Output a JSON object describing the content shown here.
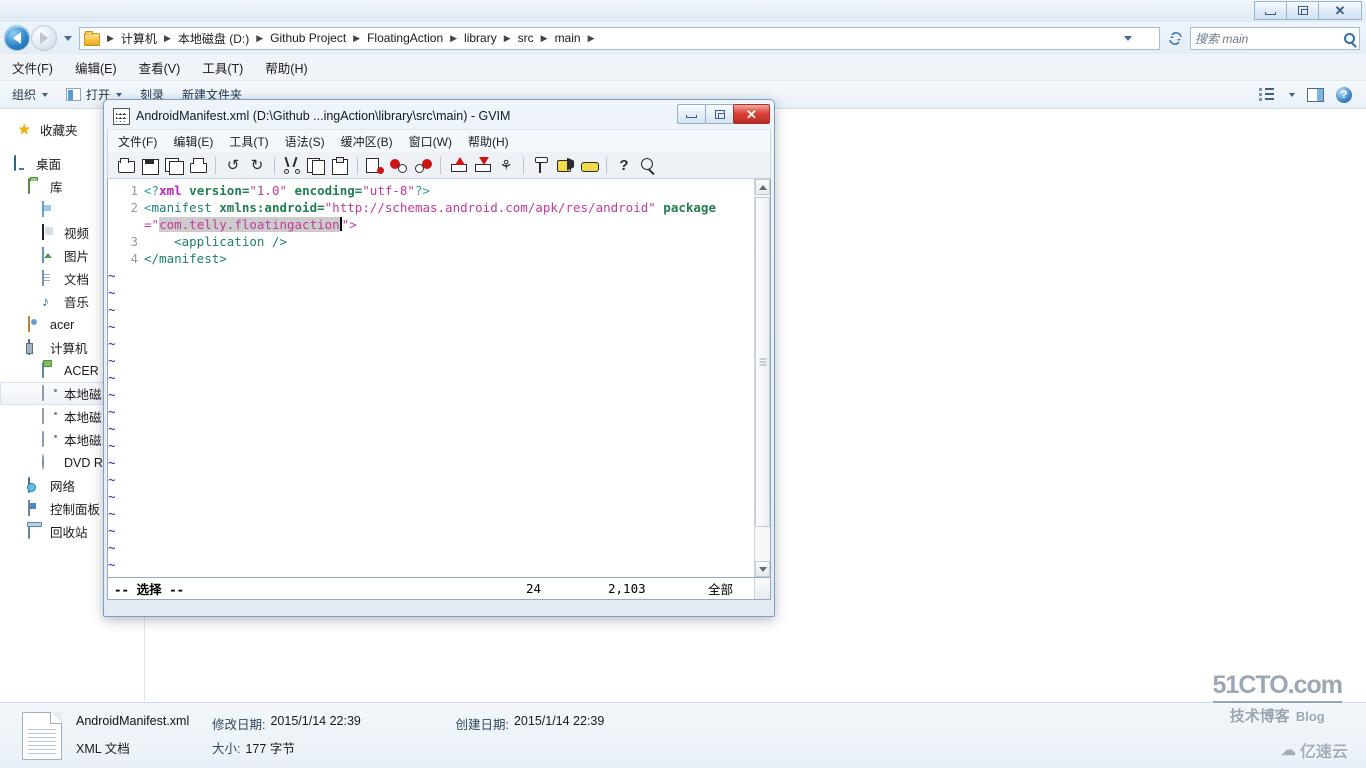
{
  "explorer": {
    "window_buttons": [
      "minimize",
      "restore",
      "close"
    ],
    "nav": {
      "back": "back-arrow",
      "forward": "forward-arrow",
      "history": "recent-pages-dropdown"
    },
    "breadcrumb": {
      "folder_icon": "folder-icon",
      "items": [
        "计算机",
        "本地磁盘 (D:)",
        "Github Project",
        "FloatingAction",
        "library",
        "src",
        "main"
      ],
      "separator": "▶"
    },
    "refresh_icon": "refresh-icon",
    "search": {
      "placeholder": "搜索 main",
      "icon": "search-icon"
    },
    "menu": [
      "文件(F)",
      "编辑(E)",
      "查看(V)",
      "工具(T)",
      "帮助(H)"
    ],
    "toolbar": {
      "organize": "组织",
      "open": "打开",
      "burn": "刻录",
      "new_folder": "新建文件夹",
      "view_icon": "view-options-icon",
      "preview_icon": "preview-pane-icon",
      "help_icon": "help-icon"
    },
    "tree": [
      {
        "label": "收藏夹",
        "icon": "favorites-star-icon",
        "indent": 18,
        "selected": false
      },
      {
        "label": "桌面",
        "icon": "desktop-icon",
        "indent": 14,
        "selected": false
      },
      {
        "label": "库",
        "icon": "libraries-icon",
        "indent": 28,
        "selected": false
      },
      {
        "label": "",
        "icon": "library-doc-icon",
        "indent": 42,
        "selected": false
      },
      {
        "label": "视频",
        "icon": "videos-icon",
        "indent": 42,
        "selected": false
      },
      {
        "label": "图片",
        "icon": "pictures-icon",
        "indent": 42,
        "selected": false
      },
      {
        "label": "文档",
        "icon": "documents-icon",
        "indent": 42,
        "selected": false
      },
      {
        "label": "音乐",
        "icon": "music-icon",
        "indent": 42,
        "selected": false
      },
      {
        "label": "acer",
        "icon": "user-folder-icon",
        "indent": 28,
        "selected": false
      },
      {
        "label": "计算机",
        "icon": "computer-icon",
        "indent": 28,
        "selected": false
      },
      {
        "label": "ACER (",
        "icon": "system-drive-icon",
        "indent": 42,
        "selected": false
      },
      {
        "label": "本地磁",
        "icon": "hard-drive-icon",
        "indent": 42,
        "selected": true
      },
      {
        "label": "本地磁",
        "icon": "hard-drive-icon",
        "indent": 42,
        "selected": false
      },
      {
        "label": "本地磁",
        "icon": "hard-drive-icon",
        "indent": 42,
        "selected": false
      },
      {
        "label": "DVD R",
        "icon": "dvd-drive-icon",
        "indent": 42,
        "selected": false
      },
      {
        "label": "网络",
        "icon": "network-icon",
        "indent": 28,
        "selected": false
      },
      {
        "label": "控制面板",
        "icon": "control-panel-icon",
        "indent": 28,
        "selected": false
      },
      {
        "label": "回收站",
        "icon": "recycle-bin-icon",
        "indent": 28,
        "selected": false
      }
    ],
    "details": {
      "file_icon": "xml-file-icon",
      "name": "AndroidManifest.xml",
      "modified_key": "修改日期:",
      "modified_value": "2015/1/14 22:39",
      "created_key": "创建日期:",
      "created_value": "2015/1/14 22:39",
      "type": "XML 文档",
      "size_key": "大小:",
      "size_value": "177 字节"
    }
  },
  "gvim": {
    "icon": "gvim-icon",
    "title": "AndroidManifest.xml (D:\\Github ...ingAction\\library\\src\\main) - GVIM",
    "window_buttons": [
      "minimize",
      "restore",
      "close"
    ],
    "menu": [
      "文件(F)",
      "编辑(E)",
      "工具(T)",
      "语法(S)",
      "缓冲区(B)",
      "窗口(W)",
      "帮助(H)"
    ],
    "toolbar_icons": [
      "open-file-icon",
      "save-file-icon",
      "save-all-icon",
      "print-icon",
      "undo-icon",
      "redo-icon",
      "cut-icon",
      "copy-icon",
      "paste-icon",
      "find-replace-icon",
      "find-next-icon",
      "find-previous-icon",
      "load-session-icon",
      "save-session-icon",
      "run-script-icon",
      "make-icon",
      "build-tags-icon",
      "tag-jump-icon",
      "help-icon",
      "find-help-icon"
    ],
    "code": {
      "line1_no": "1",
      "line2_no": "2",
      "line3_no": "3",
      "line4_no": "4",
      "l1_open": "<?",
      "l1_kw": "xml",
      "l1_attr1": " version=",
      "l1_val1": "\"1.0\"",
      "l1_attr2": " encoding=",
      "l1_val2": "\"utf-8\"",
      "l1_close": "?>",
      "l2_open": "<",
      "l2_tag": "manifest",
      "l2_attr1": " xmlns:android=",
      "l2_val1": "\"http://schemas.android.com/apk/res/android\"",
      "l2_attr2": " package",
      "l2_wrap_eq": "=\"",
      "l2_selection": "com.telly.floatingaction",
      "l2_wrap_tail": "\">",
      "l3_text": "    <application />",
      "l4_text": "</manifest>",
      "tilde": "~",
      "tilde_count": 19
    },
    "status": {
      "mode": "-- 选择 --",
      "column": "24",
      "position": "2,103",
      "scroll": "全部"
    },
    "scrollbar": "vertical-scrollbar"
  },
  "watermarks": {
    "site_main": "51CTO.com",
    "site_sub": "技术博客",
    "site_blog": "Blog",
    "cloud_icon": "cloud-icon",
    "cloud_text": "亿速云"
  }
}
